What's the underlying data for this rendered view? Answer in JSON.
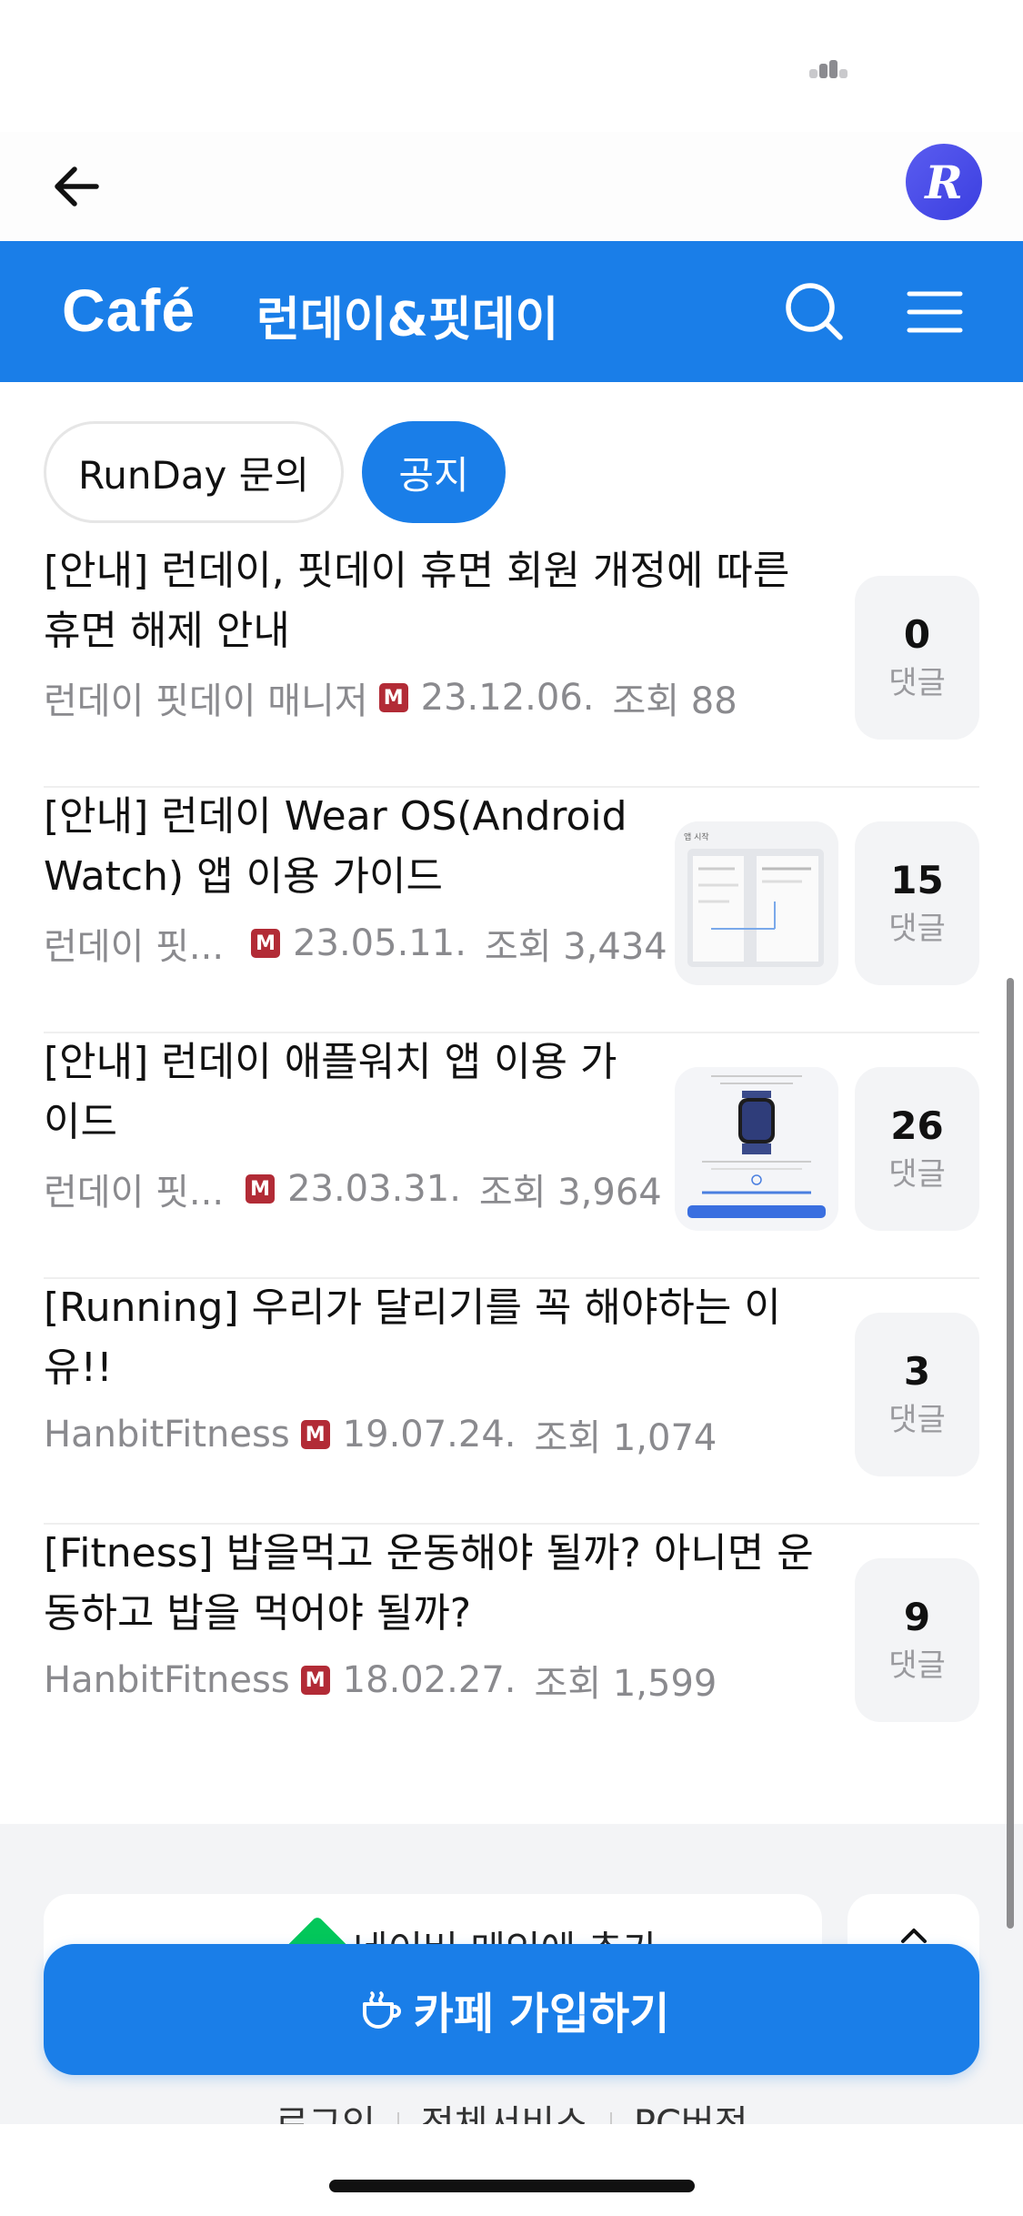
{
  "header": {
    "back_icon": "arrow-left-icon",
    "avatar_letter": "R",
    "avatar_color": "#4a4de8"
  },
  "cafe": {
    "logo": "Café",
    "name": "런데이&핏데이",
    "accent_color": "#1a7ee8",
    "search_icon": "search-icon",
    "menu_icon": "hamburger-menu-icon"
  },
  "chips": [
    {
      "label": "RunDay 문의",
      "selected": false
    },
    {
      "label": "공지",
      "selected": true
    }
  ],
  "posts": [
    {
      "title_line1": "[안내] 런데이, 핏데이 휴면 회원 개정에 따른",
      "title_line2": "휴면 해제 안내",
      "author": "런데이 핏데이 매니저",
      "badge": "M",
      "date": "23.12.06.",
      "views": "조회 88",
      "comments": "0",
      "comment_label": "댓글",
      "has_thumb": false
    },
    {
      "title_line1": "[안내] 런데이 Wear OS(Android",
      "title_line2": "Watch) 앱 이용 가이드",
      "author": "런데이 핏...",
      "badge": "M",
      "date": "23.05.11.",
      "views": "조회 3,434",
      "comments": "15",
      "comment_label": "댓글",
      "has_thumb": true
    },
    {
      "title_line1": "[안내] 런데이 애플워치 앱 이용 가",
      "title_line2": "이드",
      "author": "런데이 핏...",
      "badge": "M",
      "date": "23.03.31.",
      "views": "조회 3,964",
      "comments": "26",
      "comment_label": "댓글",
      "has_thumb": true
    },
    {
      "title_line1": "[Running] 우리가 달리기를 꼭 해야하는 이",
      "title_line2": "유!!",
      "author": "HanbitFitness",
      "badge": "M",
      "date": "19.07.24.",
      "views": "조회 1,074",
      "comments": "3",
      "comment_label": "댓글",
      "has_thumb": false
    },
    {
      "title_line1": "[Fitness] 밥을먹고 운동해야 될까? 아니면 운",
      "title_line2": "동하고 밥을 먹어야 될까?",
      "author": "HanbitFitness",
      "badge": "M",
      "date": "18.02.27.",
      "views": "조회 1,599",
      "comments": "9",
      "comment_label": "댓글",
      "has_thumb": false
    }
  ],
  "footer": {
    "naver_card_text": "네이버 메인에 추가",
    "join_button": "카페 가입하기",
    "links": [
      "로그인",
      "전체서비스",
      "PC버전"
    ]
  }
}
